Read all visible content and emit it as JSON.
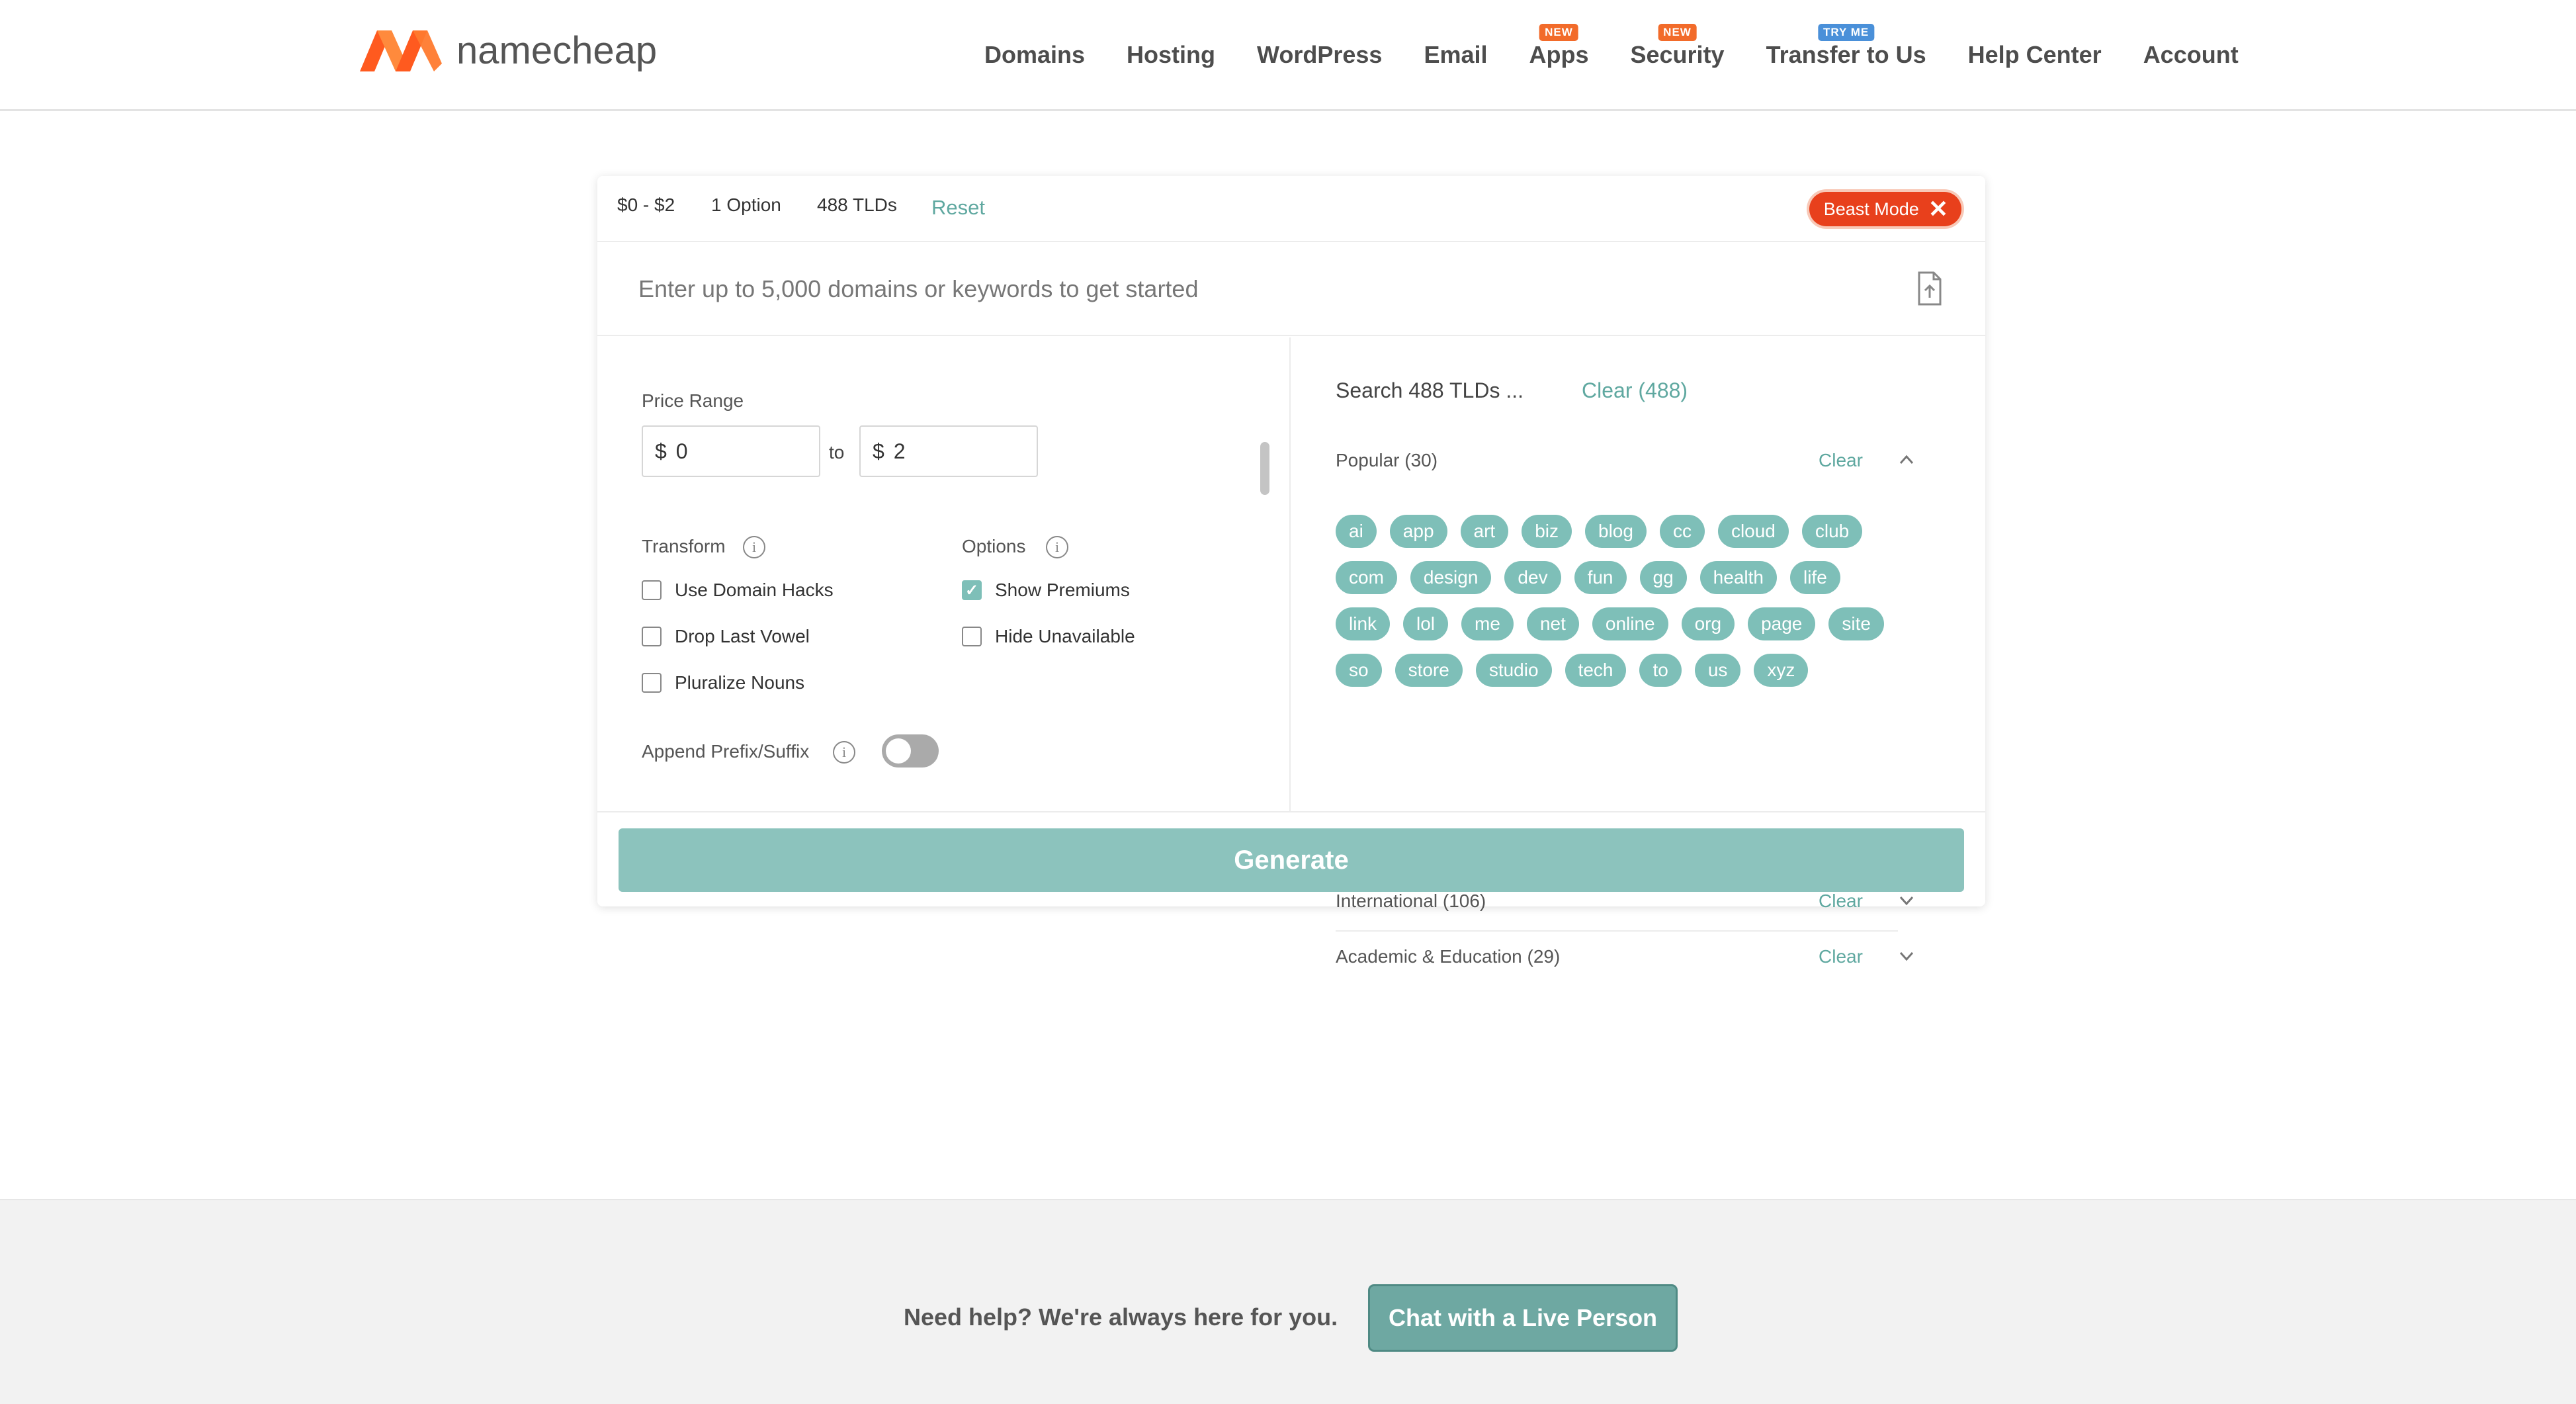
{
  "header": {
    "brand": "namecheap",
    "logo_color": "#ff6c2c",
    "nav": [
      {
        "label": "Domains",
        "badge": ""
      },
      {
        "label": "Hosting",
        "badge": ""
      },
      {
        "label": "WordPress",
        "badge": ""
      },
      {
        "label": "Email",
        "badge": ""
      },
      {
        "label": "Apps",
        "badge": "NEW"
      },
      {
        "label": "Security",
        "badge": "NEW"
      },
      {
        "label": "Transfer to Us",
        "badge": "TRY ME"
      },
      {
        "label": "Help Center",
        "badge": ""
      },
      {
        "label": "Account",
        "badge": ""
      }
    ]
  },
  "filters": {
    "price_chip": "$0 - $2",
    "option_chip": "1 Option",
    "tld_chip": "488 TLDs",
    "reset": "Reset",
    "beast_mode": "Beast Mode"
  },
  "search": {
    "placeholder": "Enter up to 5,000 domains or keywords to get started",
    "upload_icon": "file-upload-icon"
  },
  "price": {
    "label": "Price Range",
    "currency": "$",
    "min": "0",
    "to": "to",
    "max": "2"
  },
  "transform": {
    "label": "Transform",
    "items": [
      {
        "label": "Use Domain Hacks",
        "checked": false
      },
      {
        "label": "Drop Last Vowel",
        "checked": false
      },
      {
        "label": "Pluralize Nouns",
        "checked": false
      }
    ]
  },
  "options": {
    "label": "Options",
    "items": [
      {
        "label": "Show Premiums",
        "checked": true
      },
      {
        "label": "Hide Unavailable",
        "checked": false
      }
    ]
  },
  "append": {
    "label": "Append Prefix/Suffix",
    "enabled": false
  },
  "tlds": {
    "search_placeholder": "Search 488 TLDs ...",
    "clear_all": "Clear (488)",
    "groups": [
      {
        "title": "Popular (30)",
        "clear": "Clear",
        "expanded": true,
        "tags": [
          "ai",
          "app",
          "art",
          "biz",
          "blog",
          "cc",
          "cloud",
          "club",
          "com",
          "design",
          "dev",
          "fun",
          "gg",
          "health",
          "life",
          "link",
          "lol",
          "me",
          "net",
          "online",
          "org",
          "page",
          "site",
          "so",
          "store",
          "studio",
          "tech",
          "to",
          "us",
          "xyz"
        ]
      },
      {
        "title": "International (106)",
        "clear": "Clear",
        "expanded": false
      },
      {
        "title": "Academic & Education (29)",
        "clear": "Clear",
        "expanded": false
      }
    ]
  },
  "generate": {
    "label": "Generate"
  },
  "footer": {
    "help": "Need help? We're always here for you.",
    "chat": "Chat with a Live Person"
  },
  "colors": {
    "accent": "#7ebfb8",
    "brand_orange": "#ff6c2c",
    "beast_red": "#e8401c"
  }
}
